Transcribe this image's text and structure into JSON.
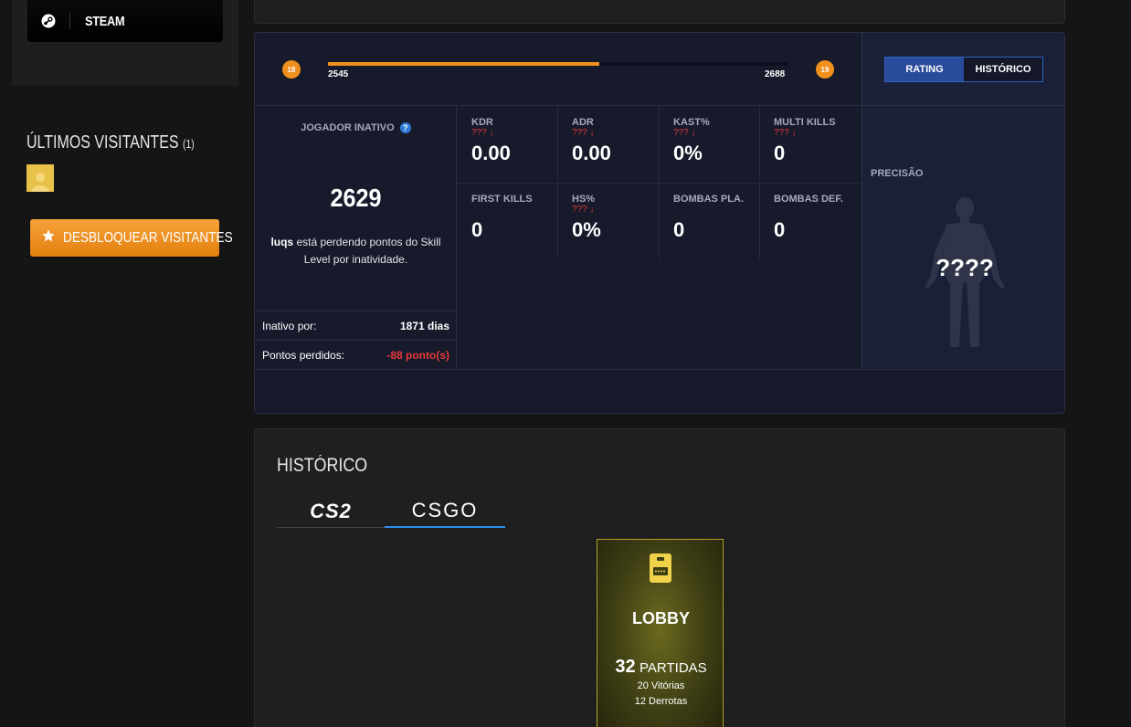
{
  "left": {
    "steam_label": "STEAM",
    "visitors_title": "ÚLTIMOS VISITANTES",
    "visitors_count": "(1)",
    "unlock_label": "DESBLOQUEAR VISITANTES"
  },
  "level": {
    "current_level": "18",
    "next_level": "19",
    "min_points": "2545",
    "max_points": "2688",
    "progress_fraction": 0.59
  },
  "toggle": {
    "rating_label": "RATING",
    "history_label": "HISTÓRICO"
  },
  "inactive": {
    "title": "JOGADOR INATIVO",
    "info_icon": "?",
    "points": "2629",
    "player_name": "luqs",
    "message": " está perdendo pontos do Skill Level por inatividade.",
    "inactive_label": "Inativo por:",
    "inactive_value": "1871 dias",
    "lost_label": "Pontos perdidos:",
    "lost_value": "-88 ponto(s)"
  },
  "metrics": [
    {
      "name": "KDR",
      "trend": "??? ↓",
      "value": "0.00"
    },
    {
      "name": "ADR",
      "trend": "??? ↓",
      "value": "0.00"
    },
    {
      "name": "KAST%",
      "trend": "??? ↓",
      "value": "0%"
    },
    {
      "name": "MULTI KILLS",
      "trend": "??? ↓",
      "value": "0"
    },
    {
      "name": "FIRST KILLS",
      "trend": "",
      "value": "0"
    },
    {
      "name": "HS%",
      "trend": "??? ↓",
      "value": "0%"
    },
    {
      "name": "BOMBAS PLA.",
      "trend": "",
      "value": "0"
    },
    {
      "name": "BOMBAS DEF.",
      "trend": "",
      "value": "0"
    }
  ],
  "precision": {
    "title": "PRECISÃO",
    "value": "????"
  },
  "history": {
    "title": "HISTÓRICO",
    "tabs": [
      "CS2",
      "CSGO"
    ],
    "active_tab": "CSGO",
    "lobby": {
      "name": "LOBBY",
      "matches_count": "32",
      "matches_label": "PARTIDAS",
      "wins": "20 Vitórias",
      "losses": "12 Derrotas"
    }
  },
  "colors": {
    "accent_orange": "#f0901d",
    "accent_blue": "#2f8fea",
    "negative_red": "#e53a3a",
    "card_bg": "#161a2b"
  }
}
